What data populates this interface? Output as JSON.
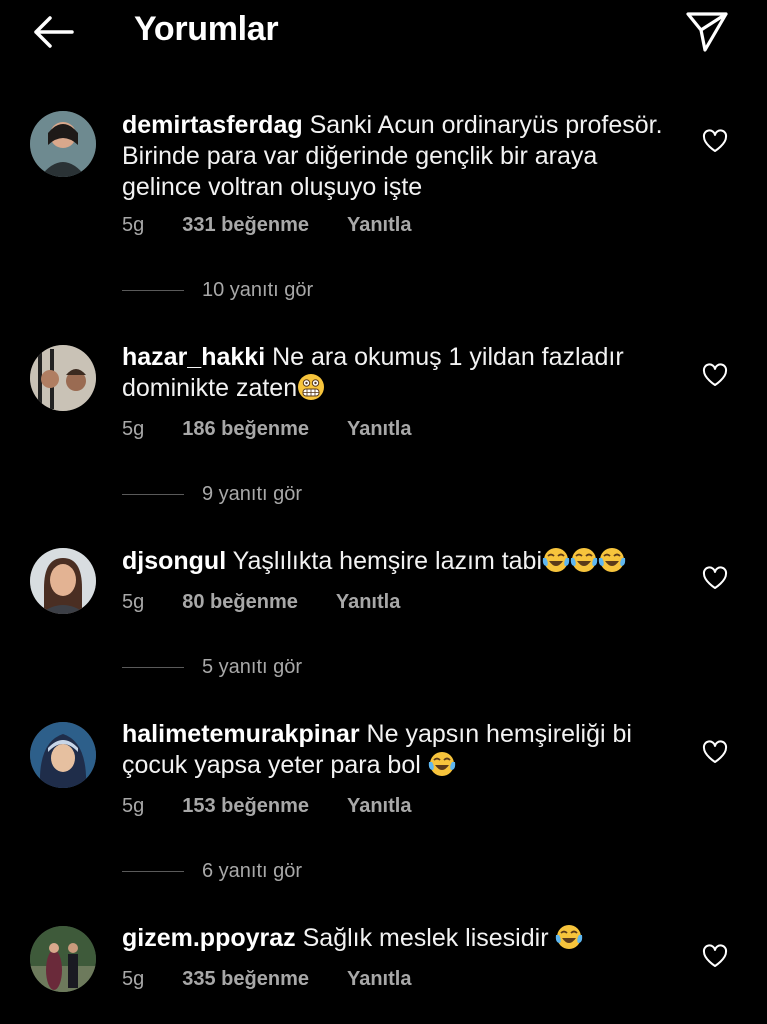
{
  "header": {
    "title": "Yorumlar"
  },
  "comments": [
    {
      "username": "demirtasferdag",
      "text": "Sanki Acun ordinaryüs profesör. Birinde para var diğerinde gençlik bir araya gelince voltran oluşuyo işte",
      "emoji": "",
      "time": "5g",
      "likes": "331 beğenme",
      "reply": "Yanıtla",
      "view_replies": "10 yanıtı gör"
    },
    {
      "username": "hazar_hakki",
      "text": "Ne ara okumuş 1 yildan fazladır dominikte zaten",
      "emoji": "grimacing-face",
      "time": "5g",
      "likes": "186 beğenme",
      "reply": "Yanıtla",
      "view_replies": "9 yanıtı gör"
    },
    {
      "username": "djsongul",
      "text": "Yaşlılıkta hemşire lazım tabi",
      "emoji": "tears-of-joy x3",
      "time": "5g",
      "likes": "80 beğenme",
      "reply": "Yanıtla",
      "view_replies": "5 yanıtı gör"
    },
    {
      "username": "halimetemurakpinar",
      "text": "Ne yapsın hemşireliği bi çocuk yapsa yeter para  bol",
      "emoji": "tears-of-joy",
      "time": "5g",
      "likes": "153 beğenme",
      "reply": "Yanıtla",
      "view_replies": "6 yanıtı gör"
    },
    {
      "username": "gizem.ppoyraz",
      "text": "Sağlık meslek lisesidir",
      "emoji": "tears-of-joy",
      "time": "5g",
      "likes": "335 beğenme",
      "reply": "Yanıtla"
    }
  ],
  "icons": {
    "back": "arrow-left-icon",
    "send": "paper-plane-icon",
    "like": "heart-outline-icon"
  },
  "colors": {
    "background": "#000000",
    "text": "#ffffff",
    "secondary": "#a8a8a8"
  }
}
